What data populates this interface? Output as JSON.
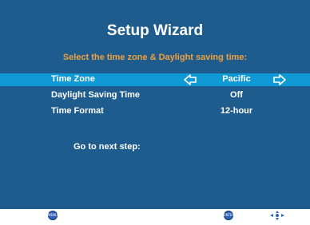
{
  "wizard": {
    "title": "Setup Wizard",
    "subtitle": "Select the time zone & Daylight saving time:"
  },
  "settings": [
    {
      "label": "Time Zone",
      "value": "Pacific",
      "selected": true
    },
    {
      "label": "Daylight Saving Time",
      "value": "Off",
      "selected": false
    },
    {
      "label": "Time Format",
      "value": "12-hour",
      "selected": false
    }
  ],
  "next_step_label": "Go to next step:",
  "footer": {
    "menu_button_text": "MENU",
    "enter_button_text": "ENTER",
    "navigation_icon": "directional-pad-icon"
  },
  "colors": {
    "panel_background": "#1f5c8e",
    "selected_row": "#0f9ad6",
    "subtitle_text": "#f0a03c",
    "button_blue": "#2f63b8"
  }
}
